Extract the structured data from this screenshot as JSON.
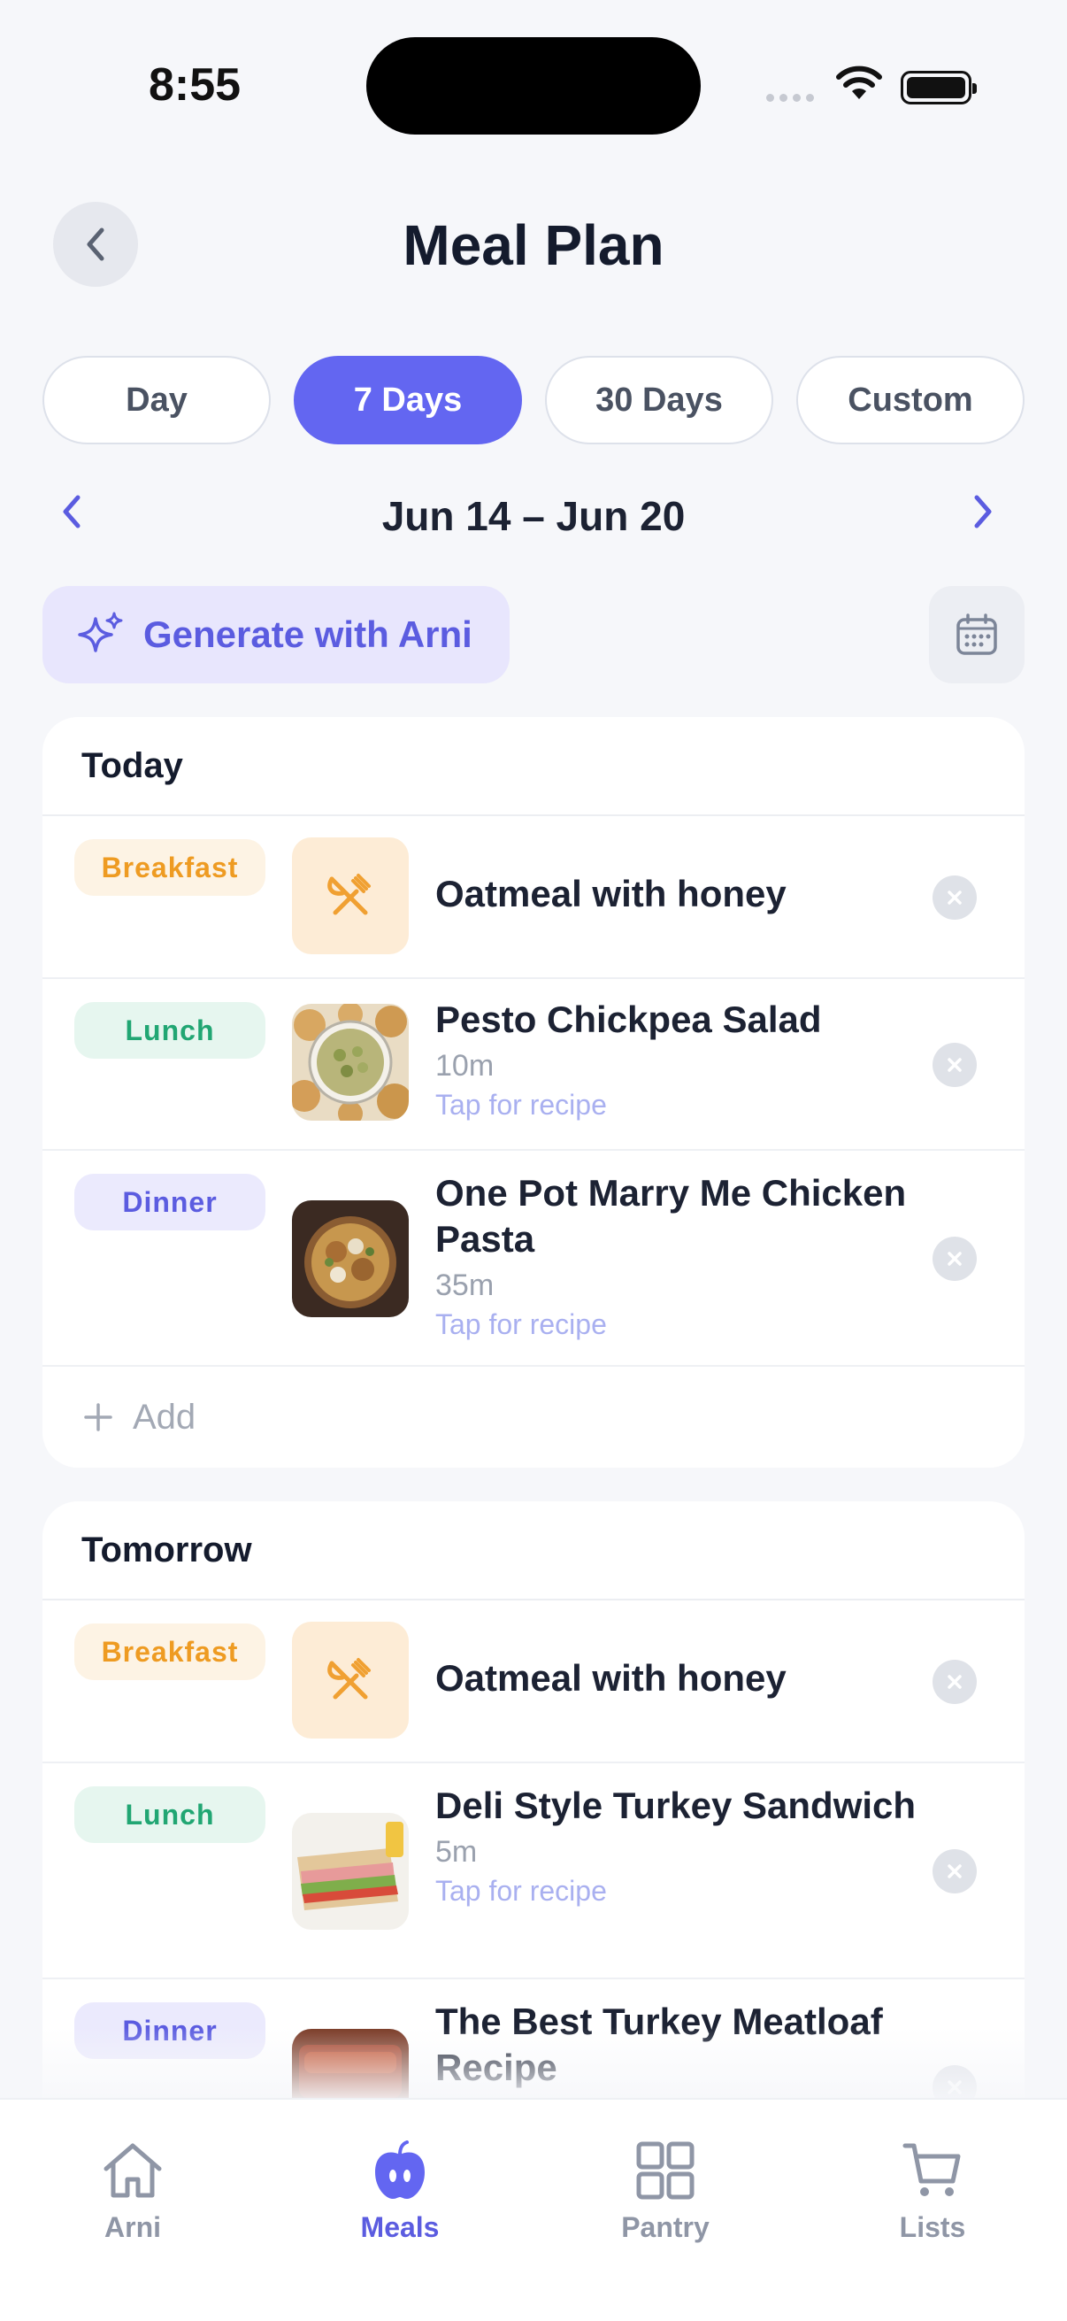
{
  "status_bar": {
    "time": "8:55"
  },
  "header": {
    "title": "Meal Plan"
  },
  "range_tabs": [
    {
      "label": "Day",
      "active": false
    },
    {
      "label": "7 Days",
      "active": true
    },
    {
      "label": "30 Days",
      "active": false
    },
    {
      "label": "Custom",
      "active": false
    }
  ],
  "date_range": {
    "label": "Jun 14 – Jun 20"
  },
  "generate": {
    "label": "Generate with Arni"
  },
  "days": [
    {
      "title": "Today",
      "meals": [
        {
          "type": "Breakfast",
          "name": "Oatmeal with honey",
          "time": "",
          "recipe": "",
          "image": "placeholder"
        },
        {
          "type": "Lunch",
          "name": "Pesto Chickpea Salad",
          "time": "10m",
          "recipe": "Tap for recipe",
          "image": "salad"
        },
        {
          "type": "Dinner",
          "name": "One Pot Marry Me Chicken Pasta",
          "time": "35m",
          "recipe": "Tap for recipe",
          "image": "pasta"
        }
      ],
      "add_label": "Add"
    },
    {
      "title": "Tomorrow",
      "meals": [
        {
          "type": "Breakfast",
          "name": "Oatmeal with honey",
          "time": "",
          "recipe": "",
          "image": "placeholder"
        },
        {
          "type": "Lunch",
          "name": "Deli Style Turkey Sandwich",
          "time": "5m",
          "recipe": "Tap for recipe",
          "image": "sandwich"
        },
        {
          "type": "Dinner",
          "name": "The Best Turkey Meatloaf Recipe",
          "time": "",
          "recipe": "",
          "image": "meatloaf"
        }
      ]
    }
  ],
  "tabbar": [
    {
      "label": "Arni",
      "icon": "home-icon",
      "active": false
    },
    {
      "label": "Meals",
      "icon": "apple-icon",
      "active": true
    },
    {
      "label": "Pantry",
      "icon": "grid-icon",
      "active": false
    },
    {
      "label": "Lists",
      "icon": "cart-icon",
      "active": false
    }
  ],
  "colors": {
    "accent": "#6366f1",
    "breakfast": "#ee9b22",
    "lunch": "#21a673",
    "dinner": "#5b5ce0"
  }
}
